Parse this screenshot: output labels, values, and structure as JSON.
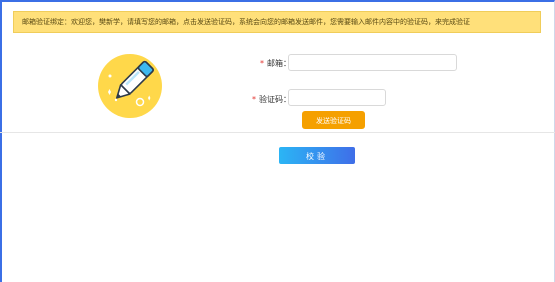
{
  "notice": {
    "text": "邮箱验证绑定：欢迎您，樊新学，请填写您的邮箱，点击发送验证码，系统会向您的邮箱发送邮件，您需要输入邮件内容中的验证码，来完成验证"
  },
  "form": {
    "email": {
      "label": "邮箱",
      "colon": "：",
      "value": "",
      "placeholder": ""
    },
    "code": {
      "label": "验证码",
      "colon": "：",
      "value": "",
      "placeholder": ""
    },
    "required_mark": "*",
    "send_button": "发送验证码",
    "verify_button": "校验"
  },
  "colors": {
    "accent_blue": "#3f6ee8",
    "notice_bg": "#ffe07a",
    "send_button": "#f5a000",
    "required": "#e3342f"
  },
  "illustration": {
    "icon": "pen-icon"
  }
}
